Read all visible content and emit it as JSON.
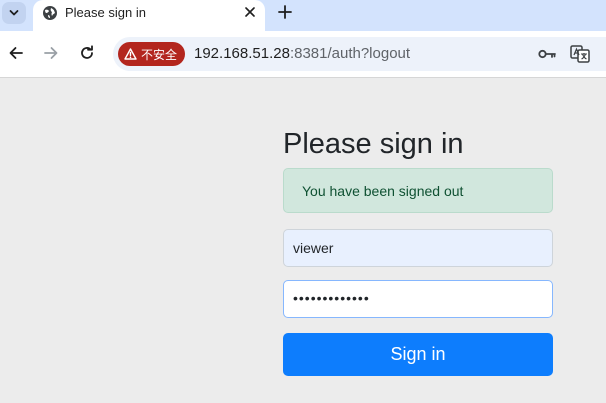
{
  "tab": {
    "title": "Please sign in"
  },
  "toolbar": {
    "security_label": "不安全",
    "url_host": "192.168.51.28",
    "url_rest": ":8381/auth?logout"
  },
  "form": {
    "heading": "Please sign in",
    "alert": "You have been signed out",
    "username_value": "viewer",
    "password_value": "•••••••••••••",
    "submit_label": "Sign in"
  },
  "colors": {
    "tabstrip": "#d3e3fd",
    "security_chip": "#b3261e",
    "alert_bg": "#d1e7dd",
    "alert_text": "#0f5132",
    "button": "#0d7dfd"
  }
}
